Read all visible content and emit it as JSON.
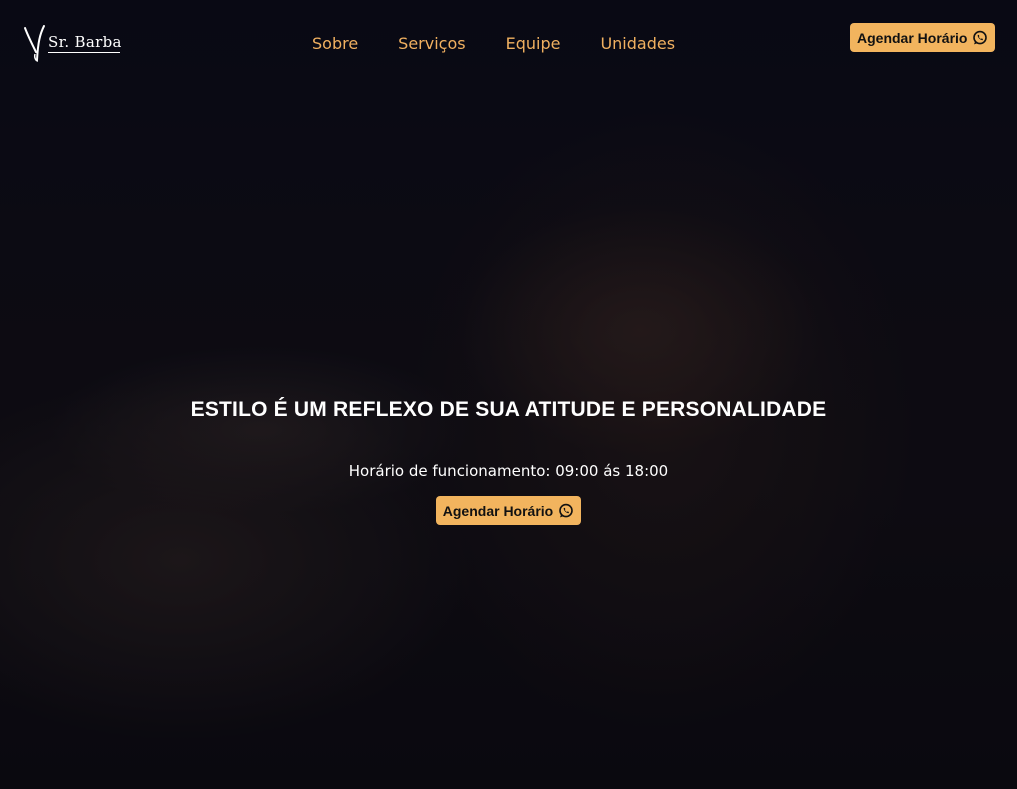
{
  "brand": {
    "name": "Sr. Barba",
    "logo_icon": "scissors-logo-icon"
  },
  "nav": {
    "items": [
      {
        "label": "Sobre"
      },
      {
        "label": "Serviços"
      },
      {
        "label": "Equipe"
      },
      {
        "label": "Unidades"
      }
    ]
  },
  "header": {
    "cta_label": "Agendar Horário",
    "cta_icon": "whatsapp-icon"
  },
  "hero": {
    "headline": "ESTILO É UM REFLEXO DE SUA ATITUDE E PERSONALIDADE",
    "hours": "Horário de funcionamento: 09:00 ás 18:00",
    "cta_label": "Agendar Horário",
    "cta_icon": "whatsapp-icon"
  },
  "colors": {
    "accent": "#f2b45e",
    "nav_text": "#f0b060",
    "background": "#0b0b14",
    "text": "#ffffff"
  }
}
